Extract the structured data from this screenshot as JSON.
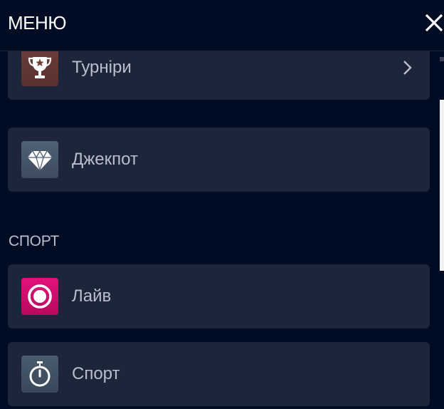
{
  "header": {
    "title": "МЕНЮ",
    "close_icon": "close-icon"
  },
  "menu": {
    "items": [
      {
        "label": "Турніри",
        "icon": "trophy-star-icon",
        "has_chevron": true,
        "icon_color": "#6b3d3a"
      },
      {
        "label": "Джекпот",
        "icon": "diamond-icon",
        "has_chevron": false,
        "icon_color": "#4f6277"
      }
    ]
  },
  "sport_section": {
    "title": "СПОРТ",
    "items": [
      {
        "label": "Лайв",
        "icon": "live-record-icon",
        "icon_color": "#e0127a"
      },
      {
        "label": "Спорт",
        "icon": "stopwatch-icon",
        "icon_color": "#4a5b6e"
      }
    ]
  },
  "colors": {
    "background": "#000c23",
    "card": "#1c2539",
    "text": "#b9bfcb",
    "title": "#ffffff"
  }
}
